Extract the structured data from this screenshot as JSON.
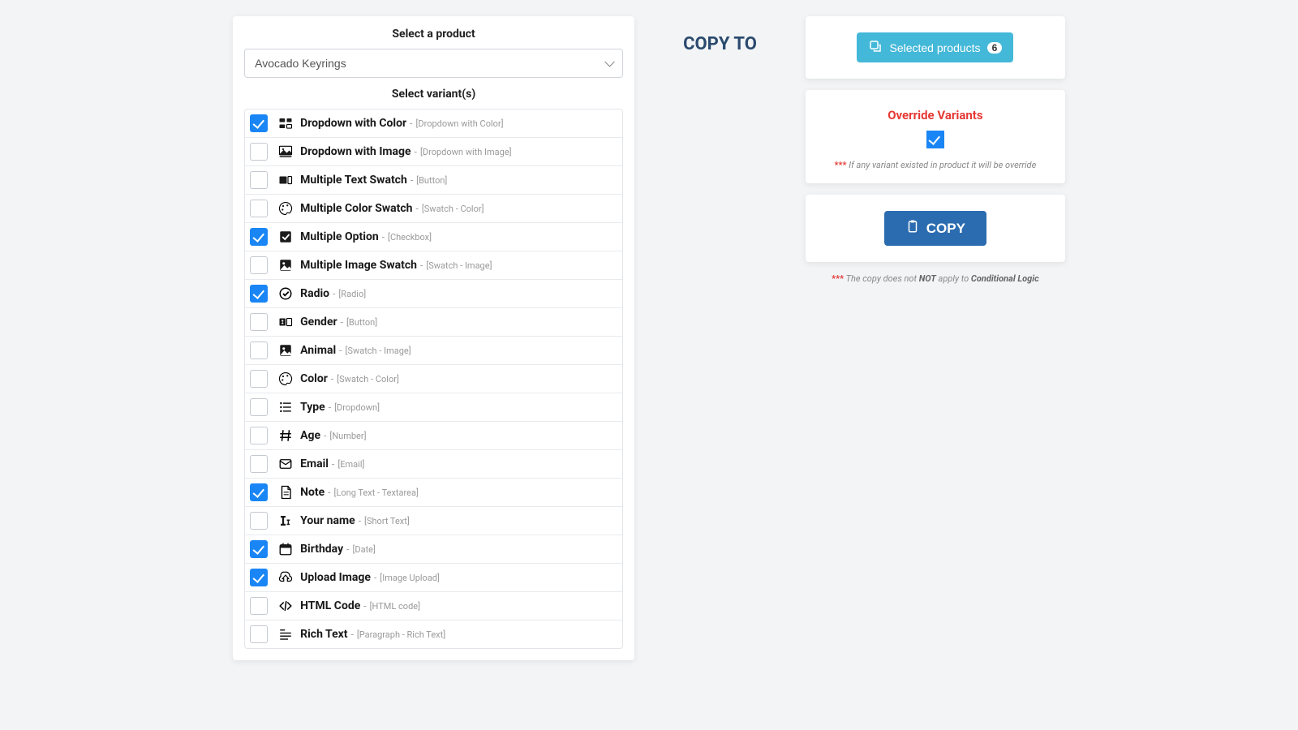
{
  "left": {
    "title_product": "Select a product",
    "product_value": "Avocado Keyrings",
    "title_variants": "Select variant(s)",
    "variants": [
      {
        "checked": true,
        "icon": "dropdown-color",
        "label": "Dropdown with Color",
        "type": "[Dropdown with Color]"
      },
      {
        "checked": false,
        "icon": "dropdown-image",
        "label": "Dropdown with Image",
        "type": "[Dropdown with Image]"
      },
      {
        "checked": false,
        "icon": "text-swatch",
        "label": "Multiple Text Swatch",
        "type": "[Button]"
      },
      {
        "checked": false,
        "icon": "palette",
        "label": "Multiple Color Swatch",
        "type": "[Swatch - Color]"
      },
      {
        "checked": true,
        "icon": "checkbox",
        "label": "Multiple Option",
        "type": "[Checkbox]"
      },
      {
        "checked": false,
        "icon": "image",
        "label": "Multiple Image Swatch",
        "type": "[Swatch - Image]"
      },
      {
        "checked": true,
        "icon": "radio",
        "label": "Radio",
        "type": "[Radio]"
      },
      {
        "checked": false,
        "icon": "gender",
        "label": "Gender",
        "type": "[Button]"
      },
      {
        "checked": false,
        "icon": "image",
        "label": "Animal",
        "type": "[Swatch - Image]"
      },
      {
        "checked": false,
        "icon": "palette",
        "label": "Color",
        "type": "[Swatch - Color]"
      },
      {
        "checked": false,
        "icon": "list",
        "label": "Type",
        "type": "[Dropdown]"
      },
      {
        "checked": false,
        "icon": "hash",
        "label": "Age",
        "type": "[Number]"
      },
      {
        "checked": false,
        "icon": "email",
        "label": "Email",
        "type": "[Email]"
      },
      {
        "checked": true,
        "icon": "longtext",
        "label": "Note",
        "type": "[Long Text - Textarea]"
      },
      {
        "checked": false,
        "icon": "shorttext",
        "label": "Your name",
        "type": "[Short Text]"
      },
      {
        "checked": true,
        "icon": "date",
        "label": "Birthday",
        "type": "[Date]"
      },
      {
        "checked": true,
        "icon": "upload",
        "label": "Upload Image",
        "type": "[Image Upload]"
      },
      {
        "checked": false,
        "icon": "code",
        "label": "HTML Code",
        "type": "[HTML code]"
      },
      {
        "checked": false,
        "icon": "richtext",
        "label": "Rich Text",
        "type": "[Paragraph - Rich Text]"
      }
    ]
  },
  "center": {
    "copy_to": "COPY TO"
  },
  "right": {
    "selected_label": "Selected products",
    "selected_count": "6",
    "override_title": "Override Variants",
    "override_checked": true,
    "override_warning_stars": "***",
    "override_warning": "If any variant existed in product it will be override",
    "copy_label": "COPY",
    "footer_stars": "***",
    "footer_pre": "The copy does not ",
    "footer_bold_not": "NOT",
    "footer_mid": " apply to ",
    "footer_bold_logic": "Conditional Logic"
  }
}
